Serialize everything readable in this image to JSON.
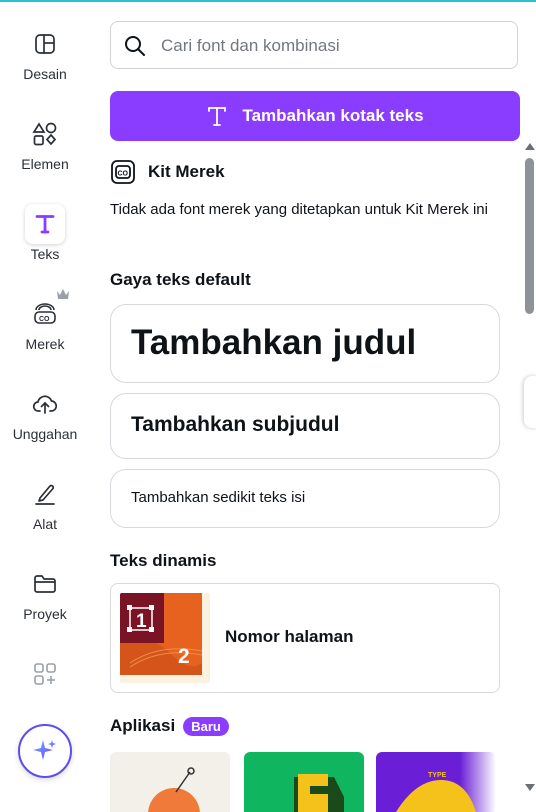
{
  "rail": {
    "items": [
      {
        "label": "Desain",
        "icon": "layout-icon"
      },
      {
        "label": "Elemen",
        "icon": "shapes-icon"
      },
      {
        "label": "Teks",
        "icon": "text-icon"
      },
      {
        "label": "Merek",
        "icon": "brand-icon"
      },
      {
        "label": "Unggahan",
        "icon": "cloud-upload-icon"
      },
      {
        "label": "Alat",
        "icon": "pen-icon"
      },
      {
        "label": "Proyek",
        "icon": "folder-icon"
      }
    ],
    "active": "Teks"
  },
  "search": {
    "placeholder": "Cari font dan kombinasi"
  },
  "add_text_button": {
    "label": "Tambahkan kotak teks"
  },
  "brand_kit": {
    "title": "Kit Merek",
    "description": "Tidak ada font merek yang ditetapkan untuk Kit Merek ini"
  },
  "default_styles": {
    "title": "Gaya teks default",
    "heading": "Tambahkan judul",
    "subheading": "Tambahkan subjudul",
    "body": "Tambahkan sedikit teks isi"
  },
  "dynamic_text": {
    "title": "Teks dinamis",
    "page_number_label": "Nomor halaman",
    "thumb_numbers": [
      "1",
      "2"
    ]
  },
  "apps": {
    "title": "Aplikasi",
    "badge": "Baru",
    "tile_text": "TYPE"
  },
  "colors": {
    "accent": "#8b3dff",
    "top_line": "#2ac1c7"
  }
}
